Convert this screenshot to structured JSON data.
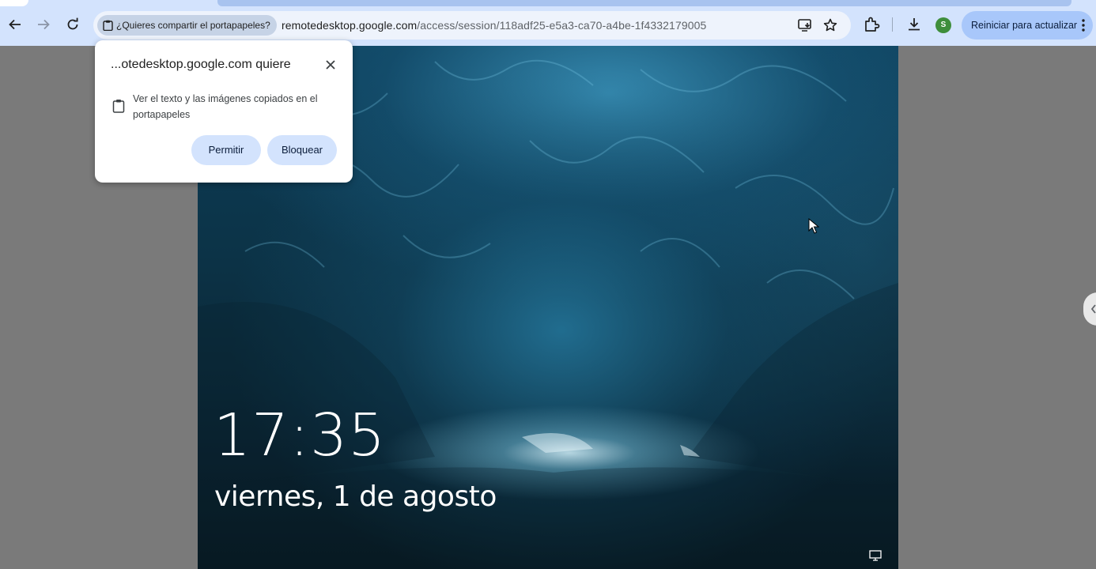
{
  "browser": {
    "chip_label": "¿Quieres compartir el portapapeles?",
    "url_host": "remotedesktop.google.com",
    "url_path": "/access/session/118adf25-e5a3-ca70-a4be-1f4332179005",
    "avatar_letter": "S",
    "update_label": "Reiniciar para actualizar"
  },
  "popup": {
    "title": "...otedesktop.google.com quiere",
    "permission_text": "Ver el texto y las imágenes copiados en el portapapeles",
    "allow_label": "Permitir",
    "block_label": "Bloquear"
  },
  "lockscreen": {
    "time": "17:35",
    "date": "viernes, 1 de agosto"
  },
  "colors": {
    "toolbar_bg": "#d3e3fd",
    "button_bg": "#d3e3fd",
    "update_bg": "#a8c7fa",
    "avatar_bg": "#3e8e3b"
  },
  "icons": [
    "back-arrow-icon",
    "forward-arrow-icon",
    "reload-icon",
    "clipboard-icon",
    "install-app-icon",
    "bookmark-star-icon",
    "extensions-icon",
    "download-icon",
    "kebab-menu-icon",
    "close-icon",
    "network-icon",
    "mouse-pointer-icon"
  ]
}
